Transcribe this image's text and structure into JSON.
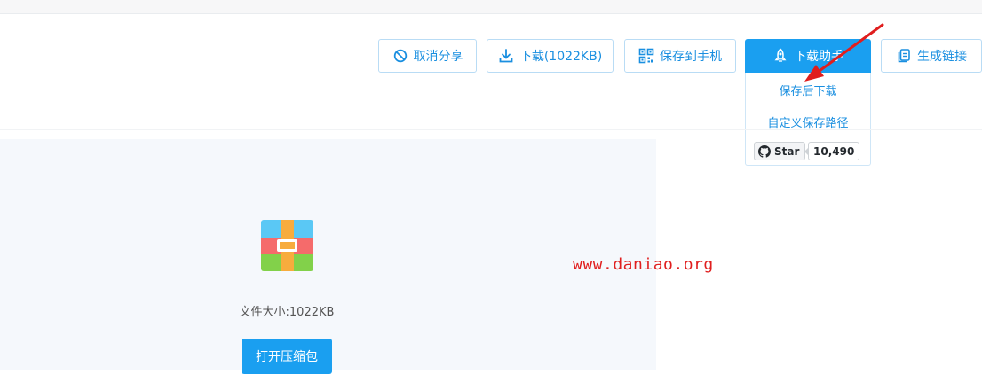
{
  "toolbar": {
    "cancel_share": "取消分享",
    "download": "下载(1022KB)",
    "save_to_phone": "保存到手机",
    "download_helper": "下载助手",
    "generate_link": "生成链接"
  },
  "dropdown": {
    "save_then_download": "保存后下载",
    "custom_save_path": "自定义保存路径",
    "github_star_label": "Star",
    "github_star_count": "10,490"
  },
  "file": {
    "size_text": "文件大小:1022KB",
    "open_button": "打开压缩包"
  },
  "watermark": "www.daniao.org",
  "colors": {
    "accent": "#1a9ff0",
    "annotation_red": "#e01e1e"
  },
  "icons": {
    "cancel_share": "ban-icon",
    "download": "download-icon",
    "save_to_phone": "qr-code-icon",
    "download_helper": "rocket-icon",
    "generate_link": "copy-link-icon",
    "file": "zip-archive-icon",
    "github": "github-icon"
  }
}
